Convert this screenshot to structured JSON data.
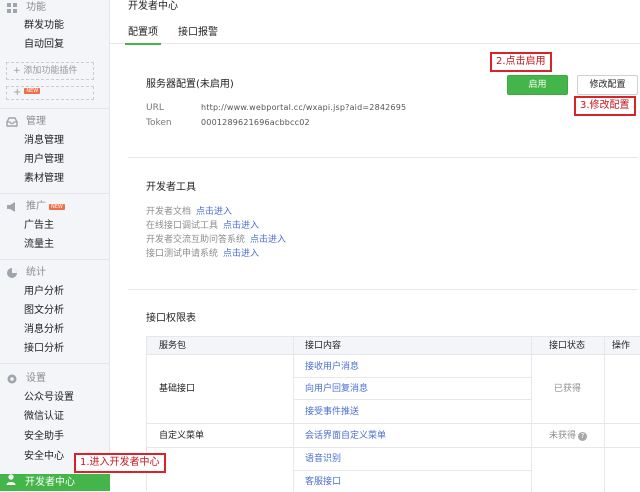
{
  "sidebar": {
    "groups": [
      {
        "title": "功能",
        "icon": "grid-icon",
        "items": [
          "群发功能",
          "自动回复"
        ]
      },
      {
        "title": "管理",
        "icon": "inbox-icon",
        "items": [
          "消息管理",
          "用户管理",
          "素材管理"
        ]
      },
      {
        "title": "推广",
        "icon": "megaphone-icon",
        "badge": "NEW",
        "items": [
          "广告主",
          "流量主"
        ]
      },
      {
        "title": "统计",
        "icon": "pie-chart-icon",
        "items": [
          "用户分析",
          "图文分析",
          "消息分析",
          "接口分析"
        ]
      },
      {
        "title": "设置",
        "icon": "gear-icon",
        "items": [
          "公众号设置",
          "微信认证",
          "安全助手",
          "安全中心"
        ]
      }
    ],
    "add_plugin_label": "+ 添加功能插件",
    "plugin_new_label": "+",
    "plugin_new_badge": "NEW",
    "active_item": {
      "label": "开发者中心",
      "icon": "user-icon"
    }
  },
  "header": {
    "title": "开发者中心"
  },
  "tabs": [
    "配置项",
    "接口报警"
  ],
  "server_config": {
    "title": "服务器配置(未启用)",
    "url_label": "URL",
    "url_value": "http://www.webportal.cc/wxapi.jsp?aid=2842695",
    "token_label": "Token",
    "token_value": "0001289621696acbbcc02",
    "enable_button": "启用",
    "modify_button": "修改配置"
  },
  "dev_tools": {
    "title": "开发者工具",
    "rows": [
      {
        "label": "开发者文档",
        "link": "点击进入"
      },
      {
        "label": "在线接口调试工具",
        "link": "点击进入"
      },
      {
        "label": "开发者交流互助问答系统",
        "link": "点击进入"
      },
      {
        "label": "接口测试申请系统",
        "link": "点击进入"
      }
    ]
  },
  "permissions": {
    "title": "接口权限表",
    "headers": [
      "服务包",
      "接口内容",
      "接口状态",
      "操作"
    ],
    "groups": [
      {
        "name": "基础接口",
        "items": [
          "接收用户消息",
          "向用户回复消息",
          "接受事件推送"
        ],
        "status": "已获得"
      },
      {
        "name": "自定义菜单",
        "items": [
          "会话界面自定义菜单"
        ],
        "status": "未获得"
      },
      {
        "name": "",
        "items": [
          "语音识别",
          "客服接口"
        ],
        "status": ""
      }
    ]
  },
  "annotations": {
    "step1": "1.进入开发者中心",
    "step2": "2.点击启用",
    "step3": "3.修改配置"
  },
  "colors": {
    "accent": "#44b549",
    "link": "#4a6ed2",
    "annotation": "#d8232a"
  }
}
